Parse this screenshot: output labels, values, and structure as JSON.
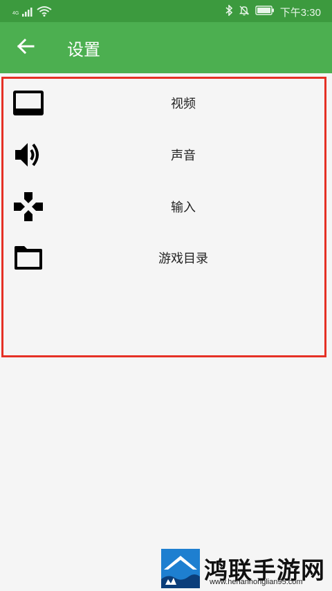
{
  "status_bar": {
    "network_label": "4G",
    "time": "下午3:30",
    "icons": [
      "signal-icon",
      "wifi-icon",
      "bluetooth-icon",
      "mute-icon",
      "battery-icon"
    ]
  },
  "app_bar": {
    "title": "设置",
    "back_icon": "arrow-back-icon",
    "background": "#4caf50",
    "status_background": "#3c9a3e"
  },
  "menu": {
    "items": [
      {
        "label": "视频",
        "icon": "video-icon"
      },
      {
        "label": "声音",
        "icon": "volume-icon"
      },
      {
        "label": "输入",
        "icon": "gamepad-icon"
      },
      {
        "label": "游戏目录",
        "icon": "folder-icon"
      }
    ],
    "highlight_color": "#e53125"
  },
  "watermark": {
    "name": "鸿联手游网",
    "url": "www.henanhonglian95.com"
  }
}
